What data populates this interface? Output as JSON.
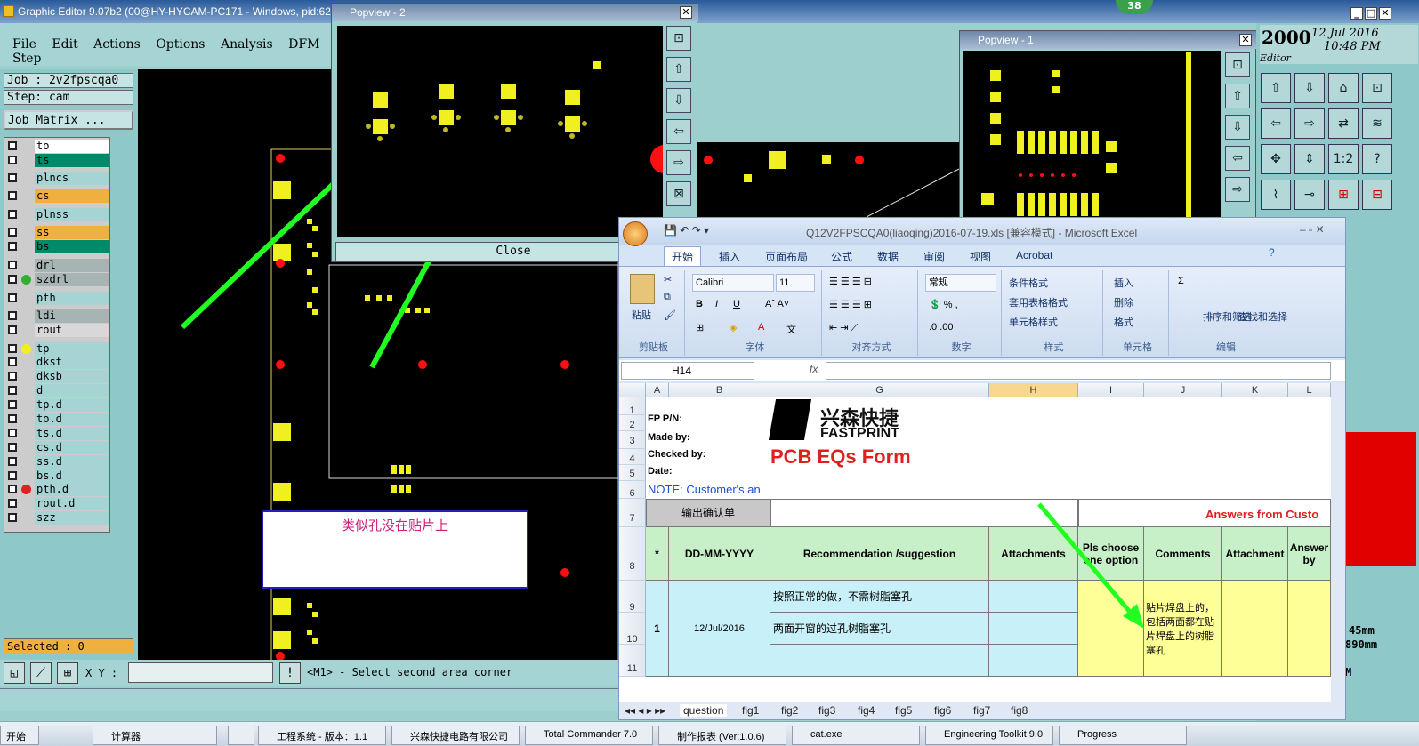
{
  "main_window": {
    "title": "Graphic Editor 9.07b2 (00@HY-HYCAM-PC171 - Windows, pid:62",
    "menu": [
      "File",
      "Edit",
      "Actions",
      "Options",
      "Analysis",
      "DFM",
      "Step"
    ]
  },
  "job_panel": {
    "job": "Job : 2v2fpscqa0",
    "step": "Step: cam",
    "matrix_button": "Job Matrix ...",
    "layers": [
      {
        "name": "to",
        "color": "#ffffff",
        "dot": ""
      },
      {
        "name": "ts",
        "color": "#008a6a",
        "dot": ""
      },
      {
        "name": "plncs",
        "color": "#a6d4d4",
        "dot": ""
      },
      {
        "name": "cs",
        "color": "#f0b040",
        "dot": ""
      },
      {
        "name": "plnss",
        "color": "#a6d4d4",
        "dot": ""
      },
      {
        "name": "ss",
        "color": "#f0b040",
        "dot": ""
      },
      {
        "name": "bs",
        "color": "#008a6a",
        "dot": ""
      },
      {
        "name": "drl",
        "color": "#a6b4b4",
        "dot": ""
      },
      {
        "name": "szdrl",
        "color": "#a6b4b4",
        "dot": "#30b030"
      },
      {
        "name": "pth",
        "color": "#a6d4d4",
        "dot": ""
      },
      {
        "name": "ldi",
        "color": "#a6b4b4",
        "dot": ""
      },
      {
        "name": "rout",
        "color": "#d8d8d8",
        "dot": ""
      },
      {
        "name": "tp",
        "color": "#a6d4d4",
        "dot": "#f0f020"
      },
      {
        "name": "dkst",
        "color": "#a6d4d4",
        "dot": ""
      },
      {
        "name": "dksb",
        "color": "#a6d4d4",
        "dot": ""
      },
      {
        "name": "d",
        "color": "#a6d4d4",
        "dot": ""
      },
      {
        "name": "tp.d",
        "color": "#a6d4d4",
        "dot": ""
      },
      {
        "name": "to.d",
        "color": "#a6d4d4",
        "dot": ""
      },
      {
        "name": "ts.d",
        "color": "#a6d4d4",
        "dot": ""
      },
      {
        "name": "cs.d",
        "color": "#a6d4d4",
        "dot": ""
      },
      {
        "name": "ss.d",
        "color": "#a6d4d4",
        "dot": ""
      },
      {
        "name": "bs.d",
        "color": "#a6d4d4",
        "dot": ""
      },
      {
        "name": "pth.d",
        "color": "#a6d4d4",
        "dot": "#e02020"
      },
      {
        "name": "rout.d",
        "color": "#a6d4d4",
        "dot": ""
      },
      {
        "name": "szz",
        "color": "#a6d4d4",
        "dot": ""
      }
    ],
    "selected": "Selected : 0"
  },
  "status": {
    "xy_label": "X Y :",
    "xy_value": "",
    "message": "<M1> - Select second area corner"
  },
  "popview2": {
    "title": "Popview - 2",
    "close": "Close"
  },
  "popview1": {
    "title": "Popview - 1"
  },
  "badge": "38",
  "right_panel": {
    "year": "2000",
    "date": "12 Jul 2016",
    "time": "10:48 PM",
    "editor_label": "Editor",
    "readout1": "45mm",
    "readout2": "890mm",
    "mode": "M"
  },
  "annotation": "类似孔没在贴片上",
  "excel": {
    "title": "Q12V2FPSCQA0(liaoqing)2016-07-19.xls  [兼容模式] - Microsoft Excel",
    "tabs": [
      "开始",
      "插入",
      "页面布局",
      "公式",
      "数据",
      "审阅",
      "视图",
      "Acrobat"
    ],
    "ribbon": {
      "paste": "粘贴",
      "clipboard": "剪贴板",
      "font_name": "Calibri",
      "font_size": "11",
      "font_group": "字体",
      "align_group": "对齐方式",
      "number_format": "常规",
      "number_group": "数字",
      "cond_format": "条件格式",
      "table_format": "套用表格格式",
      "cell_style": "单元格样式",
      "style_group": "样式",
      "insert": "插入",
      "delete": "删除",
      "format": "格式",
      "cells_group": "单元格",
      "sort": "排序和筛选",
      "find": "查找和选择",
      "edit_group": "编辑"
    },
    "name_box": "H14",
    "fx": "fx",
    "columns": [
      "A",
      "B",
      "G",
      "H",
      "I",
      "J",
      "K",
      "L"
    ],
    "rows": [
      "1",
      "2",
      "3",
      "4",
      "5",
      "6",
      "7",
      "8",
      "9",
      "10",
      "11"
    ],
    "labels": {
      "fp": "FP P/N:",
      "made": "Made by:",
      "checked": "Checked by:",
      "date": "Date:",
      "note": "NOTE: Customer's  an",
      "brand_cn": "兴森快捷",
      "brand_en": "FASTPRINT",
      "form": "PCB EQs Form",
      "export_btn": "输出确认单",
      "answers": "Answers from Custo"
    },
    "headers": [
      "*",
      "DD-MM-YYYY",
      "Recommendation /suggestion",
      "Attachments",
      "Pls choose one option",
      "Comments",
      "Attachment",
      "Answer by"
    ],
    "row": {
      "num": "1",
      "date": "12/Jul/2016",
      "s1": "按照正常的做，不需树脂塞孔",
      "s2": "两面开窗的过孔树脂塞孔",
      "comment": "贴片焊盘上的，包括两面都在贴片焊盘上的树脂塞孔"
    },
    "sheets": [
      "question",
      "fig1",
      "fig2",
      "fig3",
      "fig4",
      "fig5",
      "fig6",
      "fig7",
      "fig8"
    ]
  },
  "taskbar": [
    "开始",
    "计算器",
    "",
    "工程系统 - 版本：1.1",
    "兴森快捷电路有限公司",
    "Total Commander 7.0",
    "制作报表 (Ver:1.0.6)",
    "cat.exe",
    "Engineering Toolkit 9.0",
    "Progress"
  ]
}
